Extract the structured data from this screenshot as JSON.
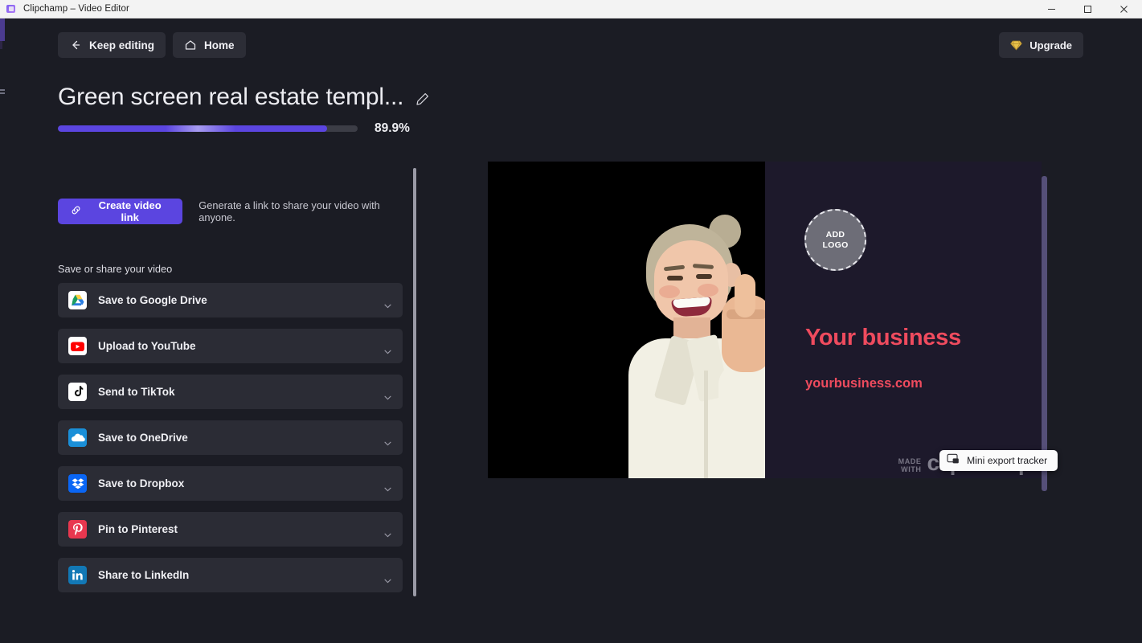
{
  "window": {
    "title": "Clipchamp – Video Editor",
    "icon": "clipchamp-app-icon",
    "controls": {
      "minimize": "minimize-icon",
      "maximize": "maximize-icon",
      "close": "close-icon"
    }
  },
  "header": {
    "keep_editing": "Keep editing",
    "keep_editing_icon": "arrow-left-icon",
    "home": "Home",
    "home_icon": "home-icon",
    "upgrade": "Upgrade",
    "upgrade_icon": "diamond-icon"
  },
  "project": {
    "title": "Green screen real estate templ...",
    "edit_icon": "pencil-icon",
    "progress_percent": "89.9%",
    "progress_value": 89.9
  },
  "share_panel": {
    "create_link_button": "Create video link",
    "create_link_icon": "link-icon",
    "create_link_hint": "Generate a link to share your video with anyone.",
    "section_label": "Save or share your video",
    "items": [
      {
        "label": "Save to Google Drive",
        "icon": "google-drive-icon",
        "chevron": "chevron-down-icon"
      },
      {
        "label": "Upload to YouTube",
        "icon": "youtube-icon",
        "chevron": "chevron-down-icon"
      },
      {
        "label": "Send to TikTok",
        "icon": "tiktok-icon",
        "chevron": "chevron-down-icon"
      },
      {
        "label": "Save to OneDrive",
        "icon": "onedrive-icon",
        "chevron": "chevron-down-icon"
      },
      {
        "label": "Save to Dropbox",
        "icon": "dropbox-icon",
        "chevron": "chevron-down-icon"
      },
      {
        "label": "Pin to Pinterest",
        "icon": "pinterest-icon",
        "chevron": "chevron-down-icon"
      },
      {
        "label": "Share to LinkedIn",
        "icon": "linkedin-icon",
        "chevron": "chevron-down-icon"
      }
    ]
  },
  "preview": {
    "add_logo_line1": "ADD",
    "add_logo_line2": "LOGO",
    "business_name": "Your business",
    "business_url": "yourbusiness.com",
    "watermark_made": "MADE",
    "watermark_with": "WITH",
    "watermark_logo": "clipchamp"
  },
  "tooltip": {
    "text": "Mini export tracker",
    "icon": "picture-in-picture-icon"
  },
  "colors": {
    "accent_purple": "#5b45e0",
    "app_background": "#1b1c24",
    "card_background": "#2b2c35",
    "preview_background": "#1d192b",
    "brand_red": "#ef4b5e",
    "upgrade_gold": "#e8c14a"
  }
}
